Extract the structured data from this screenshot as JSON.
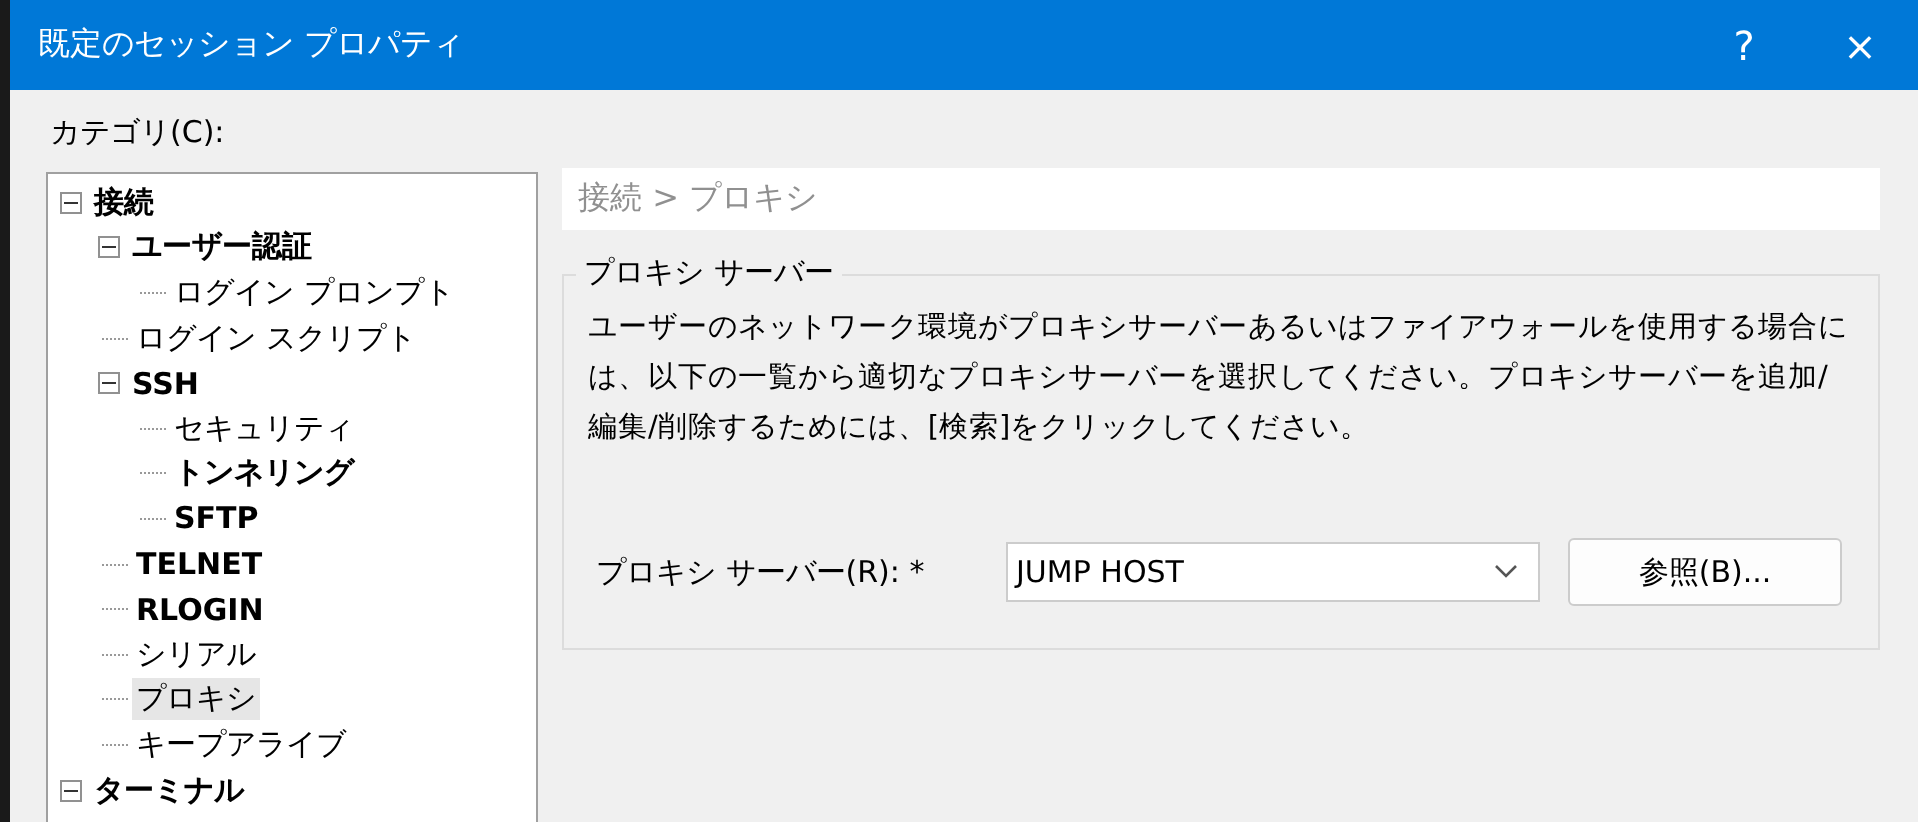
{
  "window": {
    "title": "既定のセッション プロパティ",
    "help": "?",
    "close": "×"
  },
  "category_label": "カテゴリ(C):",
  "tree": [
    {
      "label": "接続",
      "bold": true,
      "expanded": true,
      "selected": false,
      "children": [
        {
          "label": "ユーザー認証",
          "bold": true,
          "expanded": true,
          "selected": false,
          "children": [
            {
              "label": "ログイン プロンプト",
              "bold": false,
              "selected": false
            }
          ]
        },
        {
          "label": "ログイン スクリプト",
          "bold": false,
          "selected": false
        },
        {
          "label": "SSH",
          "bold": true,
          "expanded": true,
          "selected": false,
          "children": [
            {
              "label": "セキュリティ",
              "bold": false,
              "selected": false
            },
            {
              "label": "トンネリング",
              "bold": true,
              "selected": false
            },
            {
              "label": "SFTP",
              "bold": true,
              "selected": false
            }
          ]
        },
        {
          "label": "TELNET",
          "bold": true,
          "selected": false
        },
        {
          "label": "RLOGIN",
          "bold": true,
          "selected": false
        },
        {
          "label": "シリアル",
          "bold": false,
          "selected": false
        },
        {
          "label": "プロキシ",
          "bold": false,
          "selected": true
        },
        {
          "label": "キープアライブ",
          "bold": false,
          "selected": false
        }
      ]
    },
    {
      "label": "ターミナル",
      "bold": true,
      "expanded": true,
      "selected": false
    }
  ],
  "breadcrumb": "接続 > プロキシ",
  "group": {
    "legend": "プロキシ サーバー",
    "description": "ユーザーのネットワーク環境がプロキシサーバーあるいはファイアウォールを使用する場合には、以下の一覧から適切なプロキシサーバーを選択してください。プロキシサーバーを追加/編集/削除するためには、[検索]をクリックしてください。",
    "field_label": "プロキシ サーバー(R): *",
    "value": "JUMP HOST",
    "button": "参照(B)..."
  }
}
